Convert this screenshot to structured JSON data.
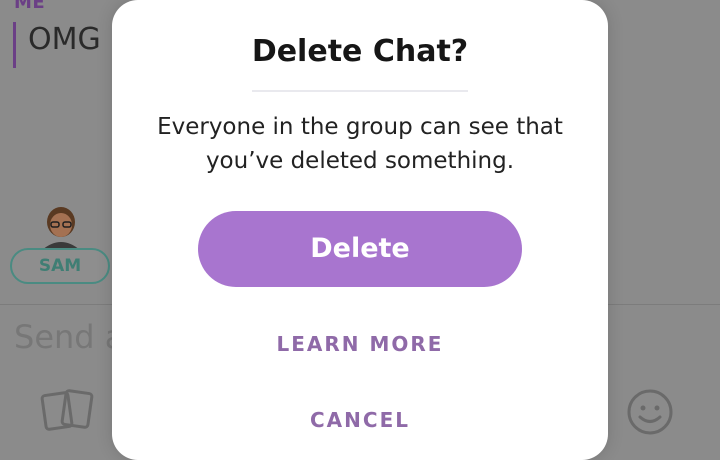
{
  "chat": {
    "sender_me": "ME",
    "message_text": "OMG",
    "contact_badge": "SAM",
    "input_placeholder": "Send a",
    "accent_color": "#6b3f86",
    "badge_color": "#4a8b82",
    "icons": [
      "chat-bitmoji-avatar",
      "cards-icon",
      "emoji-icon"
    ]
  },
  "dialog": {
    "title": "Delete Chat?",
    "message_line1": "Everyone in the group can see that",
    "message_line2": "you’ve deleted something.",
    "delete_label": "Delete",
    "learn_more_label": "LEARN MORE",
    "cancel_label": "CANCEL",
    "button_color": "#a875cf",
    "link_color": "#8f6aa8"
  }
}
